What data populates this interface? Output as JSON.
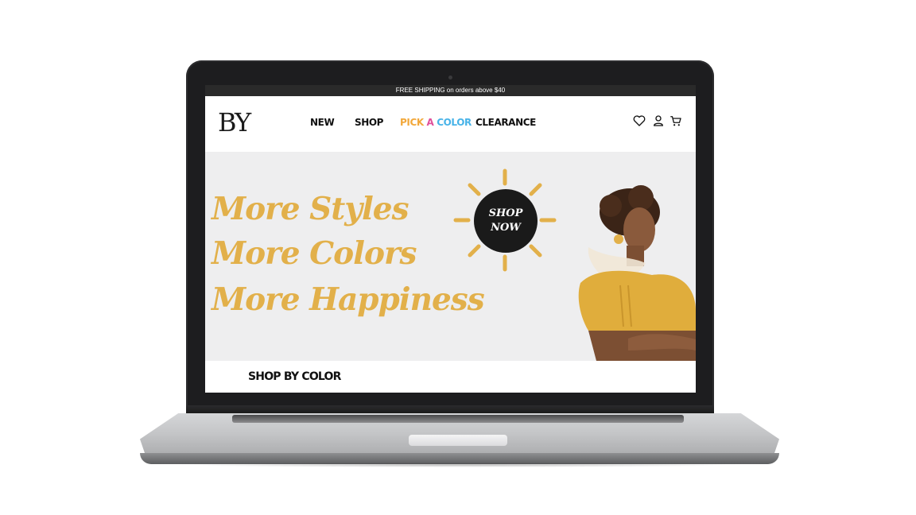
{
  "topbar": {
    "text": "FREE SHIPPING on orders above $40"
  },
  "header": {
    "logo": "BY",
    "nav": {
      "new": "NEW",
      "shop": "SHOP",
      "pick_a_color": [
        "PICK ",
        "A ",
        "COLOR"
      ],
      "clearance": "CLEARANCE"
    },
    "icons": [
      "heart-icon",
      "user-icon",
      "cart-icon"
    ]
  },
  "hero": {
    "lines": [
      "More Styles",
      "More Colors",
      "More Happiness"
    ],
    "cta": [
      "SHOP",
      "NOW"
    ]
  },
  "section": {
    "title": "SHOP BY COLOR"
  },
  "colors": {
    "accent": "#e2b04a",
    "dark": "#1a1a1a",
    "hero_bg": "#eeeeef",
    "pick_colors": [
      "#f2a83b",
      "#e04f9a",
      "#48b3e8"
    ]
  }
}
